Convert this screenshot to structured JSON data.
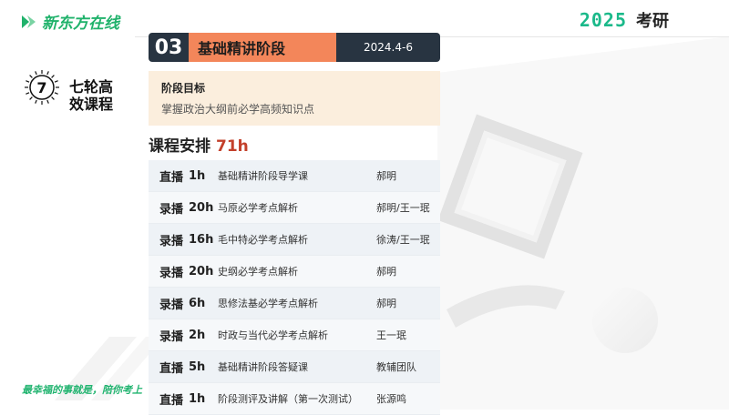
{
  "header": {
    "logo_text": "新东方在线",
    "year": "2025",
    "exam": "考研"
  },
  "round": {
    "number": "7",
    "title": "七轮高效课程"
  },
  "stage": {
    "number": "03",
    "name": "基础精讲阶段",
    "date": "2024.4-6"
  },
  "goal": {
    "title": "阶段目标",
    "text": "掌握政治大纲前必学高频知识点"
  },
  "schedule": {
    "title": "课程安排",
    "hours": "71h",
    "rows": [
      {
        "type": "直播",
        "hours": "1h",
        "title": "基础精讲阶段导学课",
        "teacher": "郝明"
      },
      {
        "type": "录播",
        "hours": "20h",
        "title": "马原必学考点解析",
        "teacher": "郝明/王一珉"
      },
      {
        "type": "录播",
        "hours": "16h",
        "title": "毛中特必学考点解析",
        "teacher": "徐涛/王一珉"
      },
      {
        "type": "录播",
        "hours": "20h",
        "title": "史纲必学考点解析",
        "teacher": "郝明"
      },
      {
        "type": "录播",
        "hours": "6h",
        "title": "思修法基必学考点解析",
        "teacher": "郝明"
      },
      {
        "type": "录播",
        "hours": "2h",
        "title": "时政与当代必学考点解析",
        "teacher": "王一珉"
      },
      {
        "type": "直播",
        "hours": "5h",
        "title": "基础精讲阶段答疑课",
        "teacher": "教辅团队"
      },
      {
        "type": "直播",
        "hours": "1h",
        "title": "阶段测评及讲解（第一次测试）",
        "teacher": "张源鸣"
      }
    ]
  },
  "footer": {
    "slogan": "最幸福的事就是，陪你考上"
  },
  "colors": {
    "brand_green": "#20b26b",
    "stage_orange": "#f3865a",
    "stage_dark": "#283441",
    "hours_red": "#c3402b",
    "goal_bg": "#fbeedd"
  }
}
